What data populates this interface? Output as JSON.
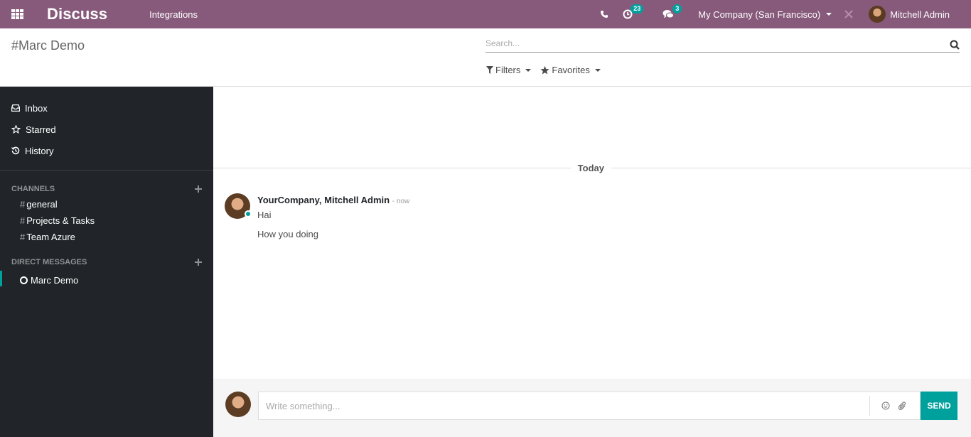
{
  "navbar": {
    "brand": "Discuss",
    "menu": "Integrations",
    "activity_count": "23",
    "messaging_count": "3",
    "company": "My Company (San Francisco)",
    "user": "Mitchell Admin"
  },
  "control_panel": {
    "breadcrumb": "#Marc Demo",
    "search_placeholder": "Search...",
    "filters_label": "Filters",
    "favorites_label": "Favorites"
  },
  "sidebar": {
    "mailboxes": [
      {
        "label": "Inbox",
        "icon": "inbox-icon"
      },
      {
        "label": "Starred",
        "icon": "star-icon"
      },
      {
        "label": "History",
        "icon": "history-icon"
      }
    ],
    "channels_title": "CHANNELS",
    "channels": [
      {
        "label": "general"
      },
      {
        "label": "Projects & Tasks"
      },
      {
        "label": "Team Azure"
      }
    ],
    "dm_title": "DIRECT MESSAGES",
    "direct_messages": [
      {
        "label": "Marc Demo",
        "active": true
      }
    ]
  },
  "thread": {
    "date_separator": "Today",
    "message": {
      "author": "YourCompany, Mitchell Admin",
      "date": "- now",
      "lines": [
        "Hai",
        "How you doing"
      ]
    }
  },
  "composer": {
    "placeholder": "Write something...",
    "send_label": "SEND"
  },
  "colors": {
    "navbar": "#875a7b",
    "sidebar": "#212529",
    "accent": "#00a09d"
  }
}
